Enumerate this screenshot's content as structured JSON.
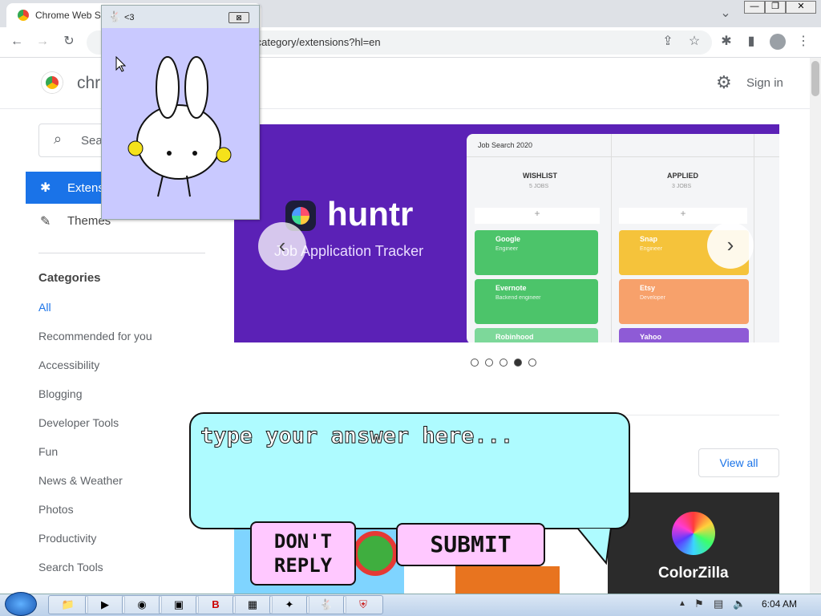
{
  "browser": {
    "tab_title": "Chrome Web St",
    "url_text": "/category/extensions?hl=en"
  },
  "header": {
    "logo_text": "chr",
    "sign_in": "Sign in"
  },
  "sidebar": {
    "search_placeholder": "Sea",
    "nav_extensions": "Extens",
    "nav_themes": "Themes",
    "categories_heading": "Categories",
    "categories": [
      "All",
      "Recommended for you",
      "Accessibility",
      "Blogging",
      "Developer Tools",
      "Fun",
      "News & Weather",
      "Photos",
      "Productivity",
      "Search Tools"
    ]
  },
  "banner": {
    "brand": "huntr",
    "tagline": "Job Application Tracker",
    "board_title": "Job Search 2020",
    "columns": [
      {
        "title": "WISHLIST",
        "sub": "5 JOBS"
      },
      {
        "title": "APPLIED",
        "sub": "3 JOBS"
      }
    ],
    "wishlist_cards": [
      {
        "name": "Google",
        "role": "Engineer",
        "color": "#4cc46a"
      },
      {
        "name": "Evernote",
        "role": "Backend engineer",
        "color": "#4cc46a"
      },
      {
        "name": "Robinhood",
        "role": "",
        "color": "#7dd89a"
      }
    ],
    "applied_cards": [
      {
        "name": "Snap",
        "role": "Engineer",
        "color": "#f5c33b"
      },
      {
        "name": "Etsy",
        "role": "Developer",
        "color": "#f7a16b"
      },
      {
        "name": "Yahoo",
        "role": "",
        "color": "#8e5bd6"
      }
    ],
    "carousel_total": 5,
    "carousel_active": 4
  },
  "featured": {
    "view_all": "View all",
    "colorzilla_label": "ColorZilla"
  },
  "popup": {
    "title": "<3"
  },
  "prompt": {
    "placeholder": "type your answer here...",
    "dont_reply": "DON'T REPLY",
    "submit": "SUBMIT"
  },
  "taskbar": {
    "time": "6:04 AM"
  },
  "colors": {
    "accent": "#1a73e8",
    "banner_bg": "#5b21b6",
    "bubble": "#aefbff",
    "popup_bg": "#c9c9ff"
  }
}
